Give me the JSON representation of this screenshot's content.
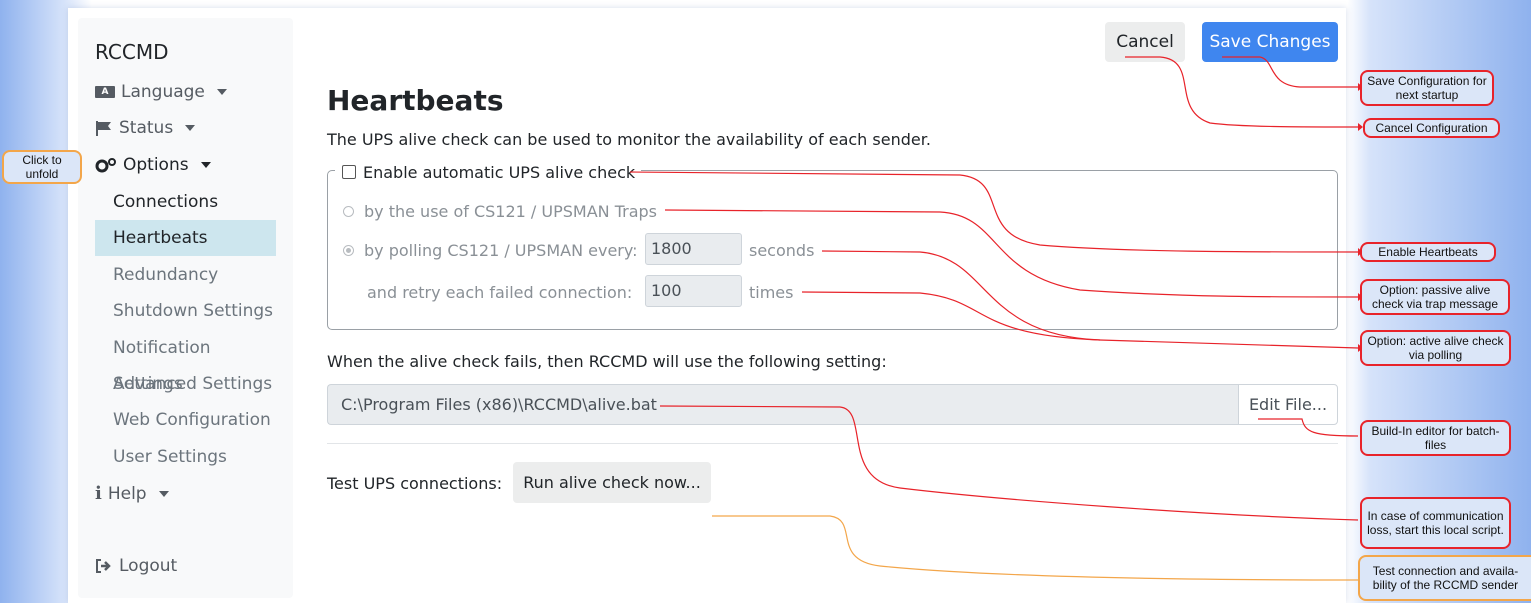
{
  "sidebar": {
    "brand": "RCCMD",
    "menus": [
      {
        "label": "Language",
        "icon": "language-icon"
      },
      {
        "label": "Status",
        "icon": "flag-icon"
      },
      {
        "label": "Options",
        "icon": "gears-icon"
      },
      {
        "label": "Help",
        "icon": "info-icon"
      },
      {
        "label": "Logout",
        "icon": "logout-icon"
      }
    ],
    "items": [
      "Connections",
      "Heartbeats",
      "Redundancy",
      "Shutdown Settings",
      "Notification Settings",
      "Advanced Settings",
      "Web Configuration",
      "User Settings"
    ],
    "active_item": "Heartbeats"
  },
  "toolbar": {
    "cancel_label": "Cancel",
    "save_label": "Save Changes"
  },
  "main": {
    "title": "Heartbeats",
    "description": "The UPS alive check can be used to monitor the availability of each sender.",
    "enable_label": "Enable automatic UPS alive check",
    "enable_checked": false,
    "option_traps": "by the use of CS121 / UPSMAN Traps",
    "option_polling": "by polling CS121 / UPSMAN every:",
    "polling_value": "1800",
    "polling_unit": "seconds",
    "retry_label": "and retry each failed connection:",
    "retry_value": "100",
    "retry_unit": "times",
    "fail_label": "When the alive check fails, then RCCMD will use the following setting:",
    "script_path": "C:\\Program Files (x86)\\RCCMD\\alive.bat",
    "edit_label": "Edit File...",
    "test_label": "Test UPS connections:",
    "run_label": "Run alive check now..."
  },
  "annotations": {
    "unfold": "Click to unfold",
    "save": "Save Configuration for next startup",
    "cancel": "Cancel Configuration",
    "enable": "Enable Heartbeats",
    "passive": "Option: passive alive check via trap message",
    "active": "Option: active alive check via polling",
    "editor": "Build-In editor for batch-files",
    "script": "In case of communication loss, start this local script.",
    "test": "Test connection and availa-bility of the RCCMD sender"
  },
  "colors": {
    "accent": "#3f86ef",
    "active_bg": "#cde6ee",
    "callout_border": "#e8232a",
    "callout_border_alt": "#f3a64a",
    "callout_fill": "#dbe6f8"
  }
}
